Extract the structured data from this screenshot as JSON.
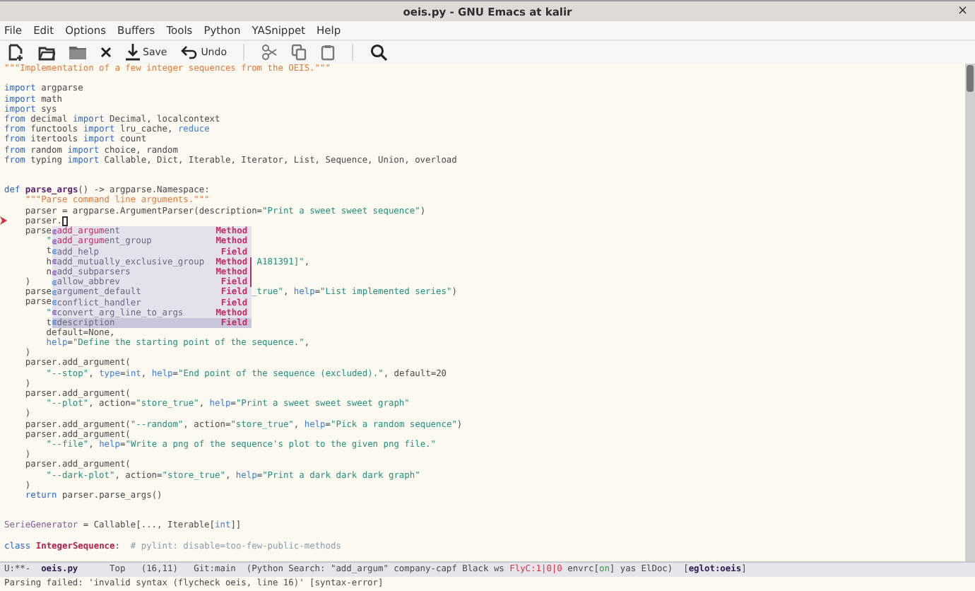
{
  "window": {
    "title": "oeis.py - GNU Emacs at kalir",
    "close": "×"
  },
  "menu": [
    "File",
    "Edit",
    "Options",
    "Buffers",
    "Tools",
    "Python",
    "YASnippet",
    "Help"
  ],
  "toolbar": [
    [
      {
        "kind": "new"
      },
      {
        "kind": "open"
      },
      {
        "kind": "dired"
      },
      {
        "kind": "kill"
      },
      {
        "kind": "save",
        "label": "Save"
      },
      {
        "kind": "undo",
        "label": "Undo"
      }
    ],
    [
      {
        "kind": "cut"
      },
      {
        "kind": "copy"
      },
      {
        "kind": "paste"
      }
    ],
    [
      {
        "kind": "search"
      }
    ]
  ],
  "code": [
    {
      "kind": "code",
      "segs": [
        {
          "kind": "docstring",
          "text": "\"\"\"Implementation of a few integer sequences from the OEIS.\"\"\""
        }
      ]
    },
    {
      "kind": "blank"
    },
    {
      "kind": "code",
      "segs": [
        {
          "kind": "keyword",
          "text": "import"
        },
        {
          "kind": "plain",
          "text": " argparse"
        }
      ]
    },
    {
      "kind": "code",
      "segs": [
        {
          "kind": "keyword",
          "text": "import"
        },
        {
          "kind": "plain",
          "text": " math"
        }
      ]
    },
    {
      "kind": "code",
      "segs": [
        {
          "kind": "keyword",
          "text": "import"
        },
        {
          "kind": "plain",
          "text": " sys"
        }
      ]
    },
    {
      "kind": "code",
      "segs": [
        {
          "kind": "keyword",
          "text": "from"
        },
        {
          "kind": "plain",
          "text": " decimal"
        },
        {
          "kind": "keyword",
          "text": " import"
        },
        {
          "kind": "plain",
          "text": " Decimal, localcontext"
        }
      ]
    },
    {
      "kind": "code",
      "segs": [
        {
          "kind": "keyword",
          "text": "from"
        },
        {
          "kind": "plain",
          "text": " functools"
        },
        {
          "kind": "keyword",
          "text": " import"
        },
        {
          "kind": "plain",
          "text": " lru_cache,"
        },
        {
          "kind": "builtin",
          "text": " reduce"
        }
      ]
    },
    {
      "kind": "code",
      "segs": [
        {
          "kind": "keyword",
          "text": "from"
        },
        {
          "kind": "plain",
          "text": " itertools"
        },
        {
          "kind": "keyword",
          "text": " import"
        },
        {
          "kind": "plain",
          "text": " count"
        }
      ]
    },
    {
      "kind": "code",
      "segs": [
        {
          "kind": "keyword",
          "text": "from"
        },
        {
          "kind": "plain",
          "text": " random"
        },
        {
          "kind": "keyword",
          "text": " import"
        },
        {
          "kind": "plain",
          "text": " choice, random"
        }
      ]
    },
    {
      "kind": "code",
      "segs": [
        {
          "kind": "keyword",
          "text": "from"
        },
        {
          "kind": "plain",
          "text": " typing"
        },
        {
          "kind": "keyword",
          "text": " import"
        },
        {
          "kind": "plain",
          "text": " Callable, Dict, Iterable, Iterator, List, Sequence, Union, overload"
        }
      ]
    },
    {
      "kind": "blank"
    },
    {
      "kind": "blank"
    },
    {
      "kind": "code",
      "segs": [
        {
          "kind": "keyword",
          "text": "def"
        },
        {
          "kind": "defname",
          "text": " parse_args"
        },
        {
          "kind": "plain",
          "text": "() -> argparse.Namespace:"
        }
      ]
    },
    {
      "kind": "code",
      "segs": [
        {
          "kind": "docstring",
          "text": "    \"\"\"Parse command line arguments.\"\"\""
        }
      ]
    },
    {
      "kind": "code",
      "segs": [
        {
          "kind": "plain",
          "text": "    parser = argparse.ArgumentParser(description="
        },
        {
          "kind": "string",
          "text": "\"Print a sweet sweet sequence\""
        },
        {
          "kind": "plain",
          "text": ")"
        }
      ]
    },
    {
      "kind": "code",
      "segs": [
        {
          "kind": "plain",
          "text": "    parser."
        }
      ],
      "cursor": true,
      "error": true
    },
    {
      "kind": "code",
      "segs": [
        {
          "kind": "plain",
          "text": "    parse"
        }
      ]
    },
    {
      "kind": "code",
      "segs": [
        {
          "kind": "string",
          "text": "        \""
        }
      ]
    },
    {
      "kind": "code",
      "segs": [
        {
          "kind": "plain",
          "text": "        t"
        }
      ]
    },
    {
      "kind": "code",
      "segs": [
        {
          "kind": "plain",
          "text": "        h"
        }
      ],
      "after": [
        {
          "kind": "string",
          "text": " A181391]\""
        },
        {
          "kind": "plain",
          "text": ","
        }
      ]
    },
    {
      "kind": "code",
      "segs": [
        {
          "kind": "plain",
          "text": "        n"
        }
      ]
    },
    {
      "kind": "code",
      "segs": [
        {
          "kind": "plain",
          "text": "    )"
        }
      ]
    },
    {
      "kind": "code",
      "segs": [
        {
          "kind": "plain",
          "text": "    parse"
        }
      ],
      "after": [
        {
          "kind": "string",
          "text": "_true\""
        },
        {
          "kind": "plain",
          "text": ","
        },
        {
          "kind": "builtin",
          "text": " help"
        },
        {
          "kind": "plain",
          "text": "="
        },
        {
          "kind": "string",
          "text": "\"List implemented series\""
        },
        {
          "kind": "plain",
          "text": ")"
        }
      ]
    },
    {
      "kind": "code",
      "segs": [
        {
          "kind": "plain",
          "text": "    parse"
        }
      ]
    },
    {
      "kind": "code",
      "segs": [
        {
          "kind": "string",
          "text": "        \""
        }
      ]
    },
    {
      "kind": "code",
      "segs": [
        {
          "kind": "plain",
          "text": "        t"
        }
      ]
    },
    {
      "kind": "code",
      "segs": [
        {
          "kind": "plain",
          "text": "        default=None,"
        }
      ]
    },
    {
      "kind": "code",
      "segs": [
        {
          "kind": "builtin",
          "text": "        help"
        },
        {
          "kind": "plain",
          "text": "="
        },
        {
          "kind": "string",
          "text": "\"Define the starting point of the sequence.\""
        },
        {
          "kind": "plain",
          "text": ","
        }
      ]
    },
    {
      "kind": "code",
      "segs": [
        {
          "kind": "plain",
          "text": "    )"
        }
      ]
    },
    {
      "kind": "code",
      "segs": [
        {
          "kind": "plain",
          "text": "    parser.add_argument("
        }
      ]
    },
    {
      "kind": "code",
      "segs": [
        {
          "kind": "string",
          "text": "        \"--stop\""
        },
        {
          "kind": "plain",
          "text": ","
        },
        {
          "kind": "builtin",
          "text": " type"
        },
        {
          "kind": "plain",
          "text": "="
        },
        {
          "kind": "builtin",
          "text": "int"
        },
        {
          "kind": "plain",
          "text": ","
        },
        {
          "kind": "builtin",
          "text": " help"
        },
        {
          "kind": "plain",
          "text": "="
        },
        {
          "kind": "string",
          "text": "\"End point of the sequence (excluded).\""
        },
        {
          "kind": "plain",
          "text": ", default=20"
        }
      ]
    },
    {
      "kind": "code",
      "segs": [
        {
          "kind": "plain",
          "text": "    )"
        }
      ]
    },
    {
      "kind": "code",
      "segs": [
        {
          "kind": "plain",
          "text": "    parser.add_argument("
        }
      ]
    },
    {
      "kind": "code",
      "segs": [
        {
          "kind": "string",
          "text": "        \"--plot\""
        },
        {
          "kind": "plain",
          "text": ", action="
        },
        {
          "kind": "string",
          "text": "\"store_true\""
        },
        {
          "kind": "plain",
          "text": ","
        },
        {
          "kind": "builtin",
          "text": " help"
        },
        {
          "kind": "plain",
          "text": "="
        },
        {
          "kind": "string",
          "text": "\"Print a sweet sweet sweet graph\""
        }
      ]
    },
    {
      "kind": "code",
      "segs": [
        {
          "kind": "plain",
          "text": "    )"
        }
      ]
    },
    {
      "kind": "code",
      "segs": [
        {
          "kind": "plain",
          "text": "    parser.add_argument("
        },
        {
          "kind": "string",
          "text": "\"--random\""
        },
        {
          "kind": "plain",
          "text": ", action="
        },
        {
          "kind": "string",
          "text": "\"store_true\""
        },
        {
          "kind": "plain",
          "text": ","
        },
        {
          "kind": "builtin",
          "text": " help"
        },
        {
          "kind": "plain",
          "text": "="
        },
        {
          "kind": "string",
          "text": "\"Pick a random sequence\""
        },
        {
          "kind": "plain",
          "text": ")"
        }
      ]
    },
    {
      "kind": "code",
      "segs": [
        {
          "kind": "plain",
          "text": "    parser.add_argument("
        }
      ]
    },
    {
      "kind": "code",
      "segs": [
        {
          "kind": "string",
          "text": "        \"--file\""
        },
        {
          "kind": "plain",
          "text": ","
        },
        {
          "kind": "builtin",
          "text": " help"
        },
        {
          "kind": "plain",
          "text": "="
        },
        {
          "kind": "string",
          "text": "\"Write a png of the sequence's plot to the given png file.\""
        }
      ]
    },
    {
      "kind": "code",
      "segs": [
        {
          "kind": "plain",
          "text": "    )"
        }
      ]
    },
    {
      "kind": "code",
      "segs": [
        {
          "kind": "plain",
          "text": "    parser.add_argument("
        }
      ]
    },
    {
      "kind": "code",
      "segs": [
        {
          "kind": "string",
          "text": "        \"--dark-plot\""
        },
        {
          "kind": "plain",
          "text": ", action="
        },
        {
          "kind": "string",
          "text": "\"store_true\""
        },
        {
          "kind": "plain",
          "text": ","
        },
        {
          "kind": "builtin",
          "text": " help"
        },
        {
          "kind": "plain",
          "text": "="
        },
        {
          "kind": "string",
          "text": "\"Print a dark dark dark graph\""
        }
      ]
    },
    {
      "kind": "code",
      "segs": [
        {
          "kind": "plain",
          "text": "    )"
        }
      ]
    },
    {
      "kind": "code",
      "segs": [
        {
          "kind": "keyword",
          "text": "    return"
        },
        {
          "kind": "plain",
          "text": " parser.parse_args()"
        }
      ]
    },
    {
      "kind": "blank"
    },
    {
      "kind": "blank"
    },
    {
      "kind": "code",
      "segs": [
        {
          "kind": "type",
          "text": "SerieGenerator"
        },
        {
          "kind": "plain",
          "text": " = Callable[..., Iterable["
        },
        {
          "kind": "builtin",
          "text": "int"
        },
        {
          "kind": "plain",
          "text": "]]"
        }
      ]
    },
    {
      "kind": "blank"
    },
    {
      "kind": "code",
      "segs": [
        {
          "kind": "keyword",
          "text": "class"
        },
        {
          "kind": "classname",
          "text": " IntegerSequence"
        },
        {
          "kind": "plain",
          "text": ":"
        },
        {
          "kind": "comment",
          "text": "  # pylint: disable=too-few-public-methods"
        }
      ]
    }
  ],
  "completion": [
    {
      "kind": "method",
      "match": "add_argum",
      "rest": "ent",
      "type": "Method",
      "selected": false
    },
    {
      "kind": "method",
      "match": "add_argum",
      "rest": "ent_group",
      "type": "Method",
      "selected": false
    },
    {
      "kind": "field",
      "rest": "add_help",
      "type": "Field",
      "selected": false
    },
    {
      "kind": "method",
      "rest": "add_mutually_exclusive_group",
      "type": "Method",
      "selected": false
    },
    {
      "kind": "method",
      "rest": "add_subparsers",
      "type": "Method",
      "selected": false
    },
    {
      "kind": "field",
      "rest": "allow_abbrev",
      "type": "Field",
      "selected": false
    },
    {
      "kind": "field",
      "rest": "argument_default",
      "type": "Field",
      "selected": false
    },
    {
      "kind": "field",
      "rest": "conflict_handler",
      "type": "Field",
      "selected": false
    },
    {
      "kind": "method",
      "rest": "convert_arg_line_to_args",
      "type": "Method",
      "selected": false
    },
    {
      "kind": "field",
      "rest": "description",
      "type": "Field",
      "selected": true
    }
  ],
  "mode_line": [
    {
      "kind": "plain",
      "text": "U:**-  "
    },
    {
      "kind": "bold",
      "text": "oeis.py"
    },
    {
      "kind": "plain",
      "text": "      Top   (16,11)   Git:main  (Python Search: \"add_argum\" company-capf Black ws "
    },
    {
      "kind": "error",
      "text": "FlyC:1|0|0"
    },
    {
      "kind": "plain",
      "text": " envrc["
    },
    {
      "kind": "ok",
      "text": "on"
    },
    {
      "kind": "plain",
      "text": "] yas ElDoc)  ["
    },
    {
      "kind": "bold",
      "text": "eglot:oeis"
    },
    {
      "kind": "plain",
      "text": "]"
    }
  ],
  "echo": "Parsing failed: 'invalid syntax (flycheck oeis, line 16)' [syntax-error]"
}
